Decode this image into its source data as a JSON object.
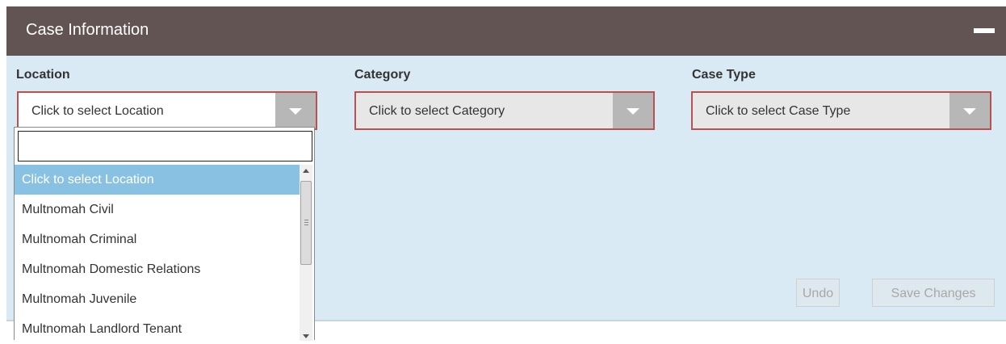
{
  "panel": {
    "title": "Case Information",
    "collapse_icon": "minus-icon"
  },
  "fields": [
    {
      "label": "Location",
      "value": "Click to select Location"
    },
    {
      "label": "Category",
      "value": "Click to select Category"
    },
    {
      "label": "Case Type",
      "value": "Click to select Case Type"
    }
  ],
  "location_dropdown": {
    "search_value": "",
    "options": [
      "Click to select Location",
      "Multnomah Civil",
      "Multnomah Criminal",
      "Multnomah Domestic Relations",
      "Multnomah Juvenile",
      "Multnomah Landlord Tenant"
    ],
    "highlighted_index": 0
  },
  "buttons": {
    "undo": "Undo",
    "save": "Save Changes"
  },
  "colors": {
    "header_bg": "#625452",
    "panel_bg": "#d9eaf5",
    "select_border": "#b9514e",
    "highlight": "#88c1e1"
  }
}
